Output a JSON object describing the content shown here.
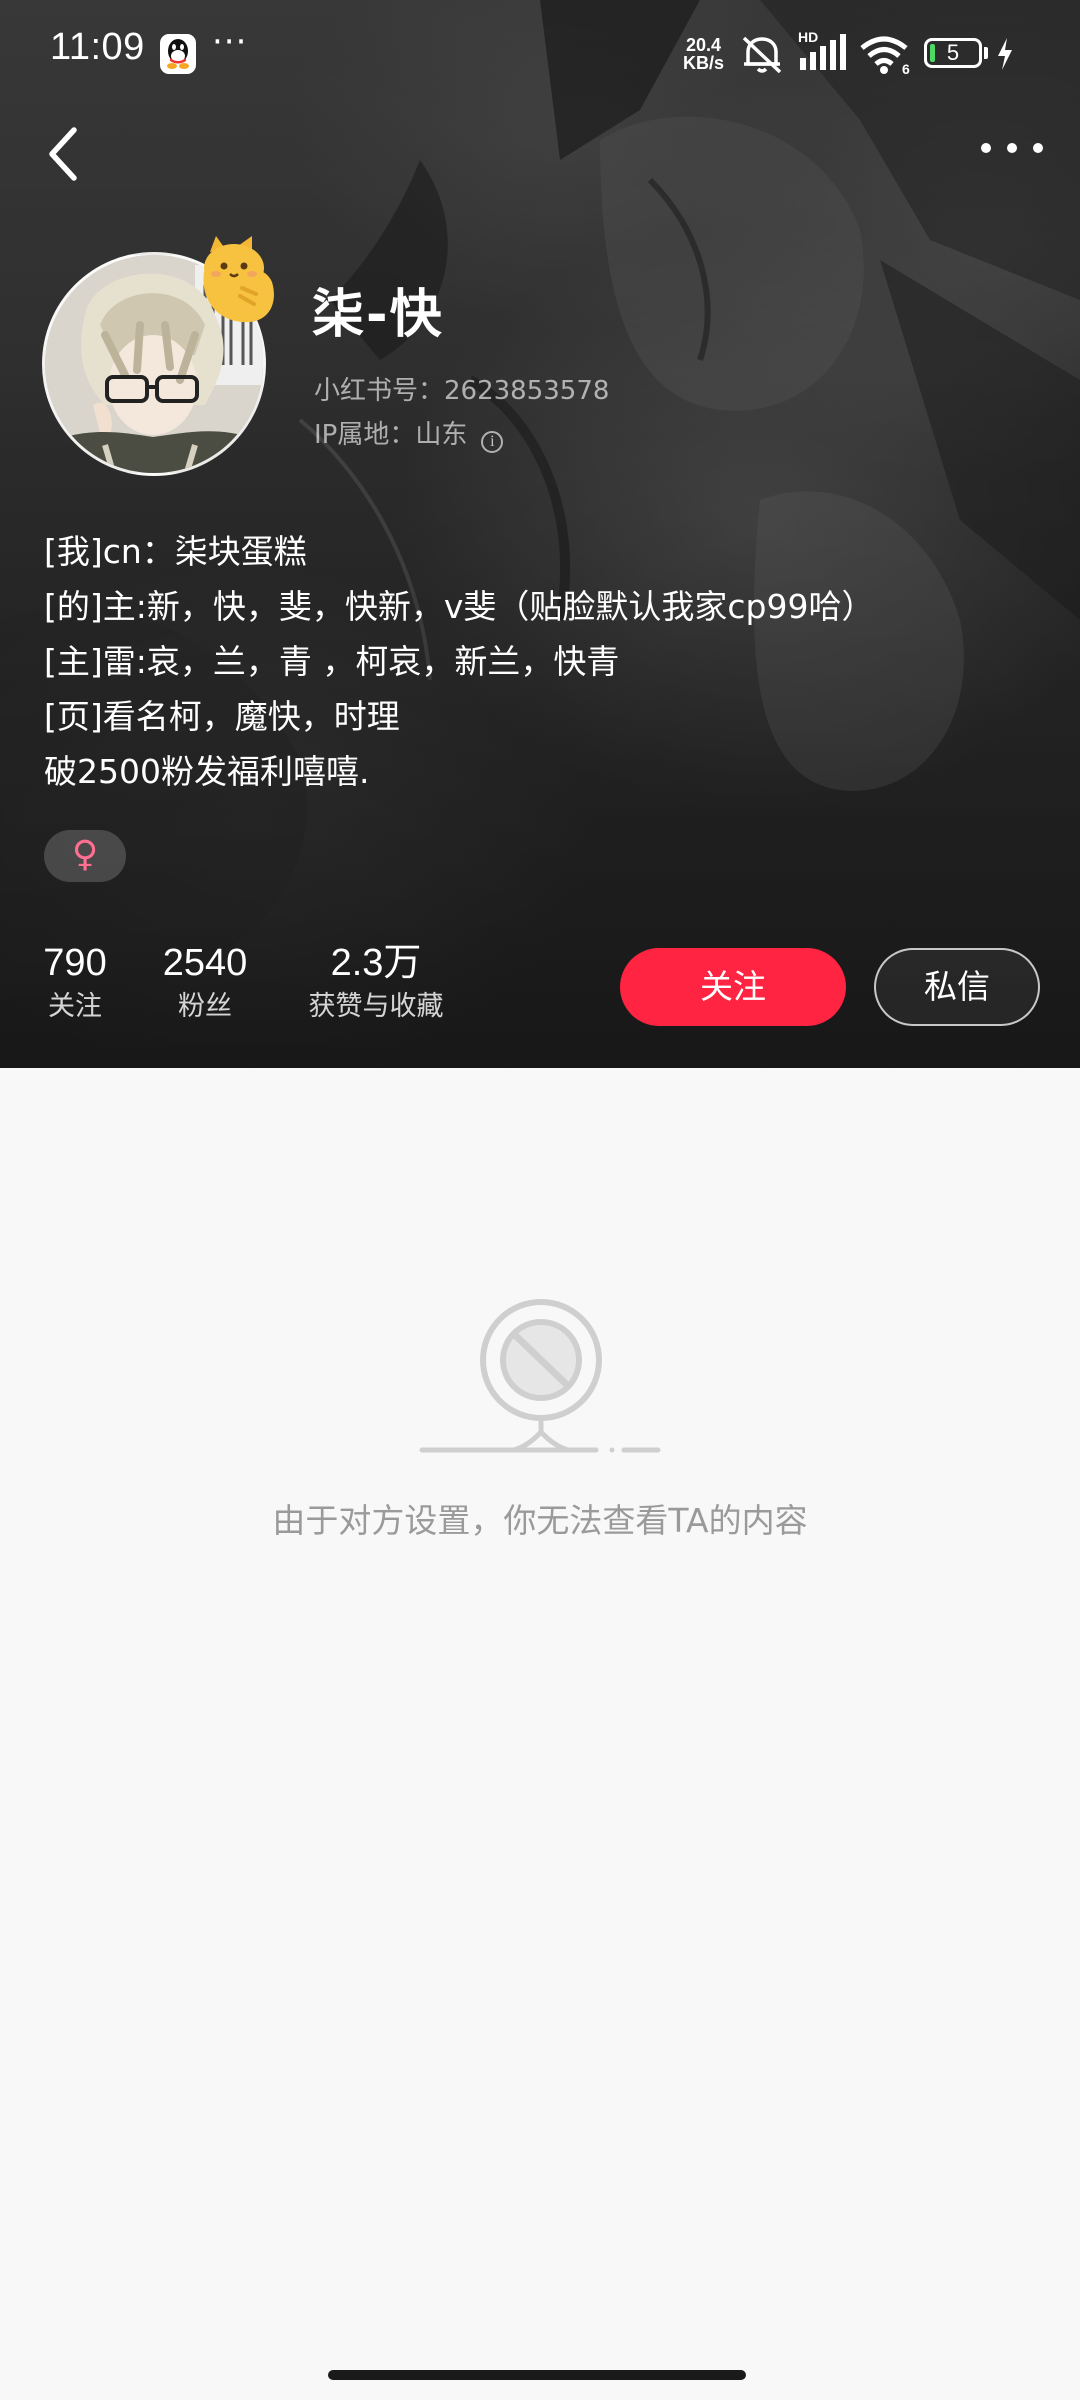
{
  "status_bar": {
    "time": "11:09",
    "more_dots": "···",
    "net_speed_value": "20.4",
    "net_speed_unit": "KB/s",
    "signal_label": "HD",
    "wifi_label": "6",
    "battery_level": "5"
  },
  "profile": {
    "nickname": "柒-快",
    "red_id_label": "小红书号：2623853578",
    "ip_label": "IP属地：山东",
    "info_icon": "i",
    "bio": [
      "[我]cn：柒块蛋糕",
      "[的]主:新，快，斐，快新，v斐（贴脸默认我家cp99哈）",
      "[主]雷:哀，兰，青 ，柯哀，新兰，快青",
      "[页]看名柯，魔快，时理",
      "破2500粉发福利嘻嘻."
    ],
    "gender_symbol": "♀"
  },
  "stats": {
    "following_count": "790",
    "following_label": "关注",
    "followers_count": "2540",
    "followers_label": "粉丝",
    "likes_count": "2.3万",
    "likes_label": "获赞与收藏"
  },
  "actions": {
    "follow_label": "关注",
    "message_label": "私信"
  },
  "empty_state": {
    "message": "由于对方设置，你无法查看TA的内容"
  },
  "colors": {
    "accent": "#ff2442",
    "page_background": "#f8f8f8",
    "empty_text": "#9a9a9a"
  },
  "icons": {
    "back": "chevron-left-icon",
    "more": "more-horizontal-icon",
    "info": "info-icon",
    "gender": "female-icon",
    "empty": "blocked-content-icon"
  }
}
